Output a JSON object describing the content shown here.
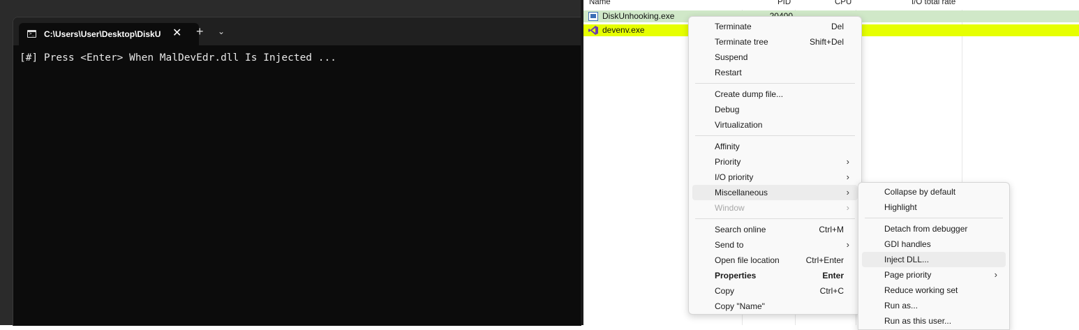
{
  "terminal": {
    "tab_title": "C:\\Users\\User\\Desktop\\DiskU",
    "tab_close": "✕",
    "new_tab": "+",
    "dropdown": "⌄",
    "output": "[#] Press <Enter> When MalDevEdr.dll Is Injected ..."
  },
  "process_list": {
    "columns": [
      "Name",
      "PID",
      "CPU",
      "I/O total rate"
    ],
    "rows": [
      {
        "name": "DiskUnhooking.exe",
        "pid": "20400",
        "highlight": "#d0e8c8"
      },
      {
        "name": "devenv.exe",
        "pid": "",
        "highlight": "#e6ff00"
      }
    ]
  },
  "context_menu": {
    "items": [
      {
        "label": "Terminate",
        "shortcut": "Del"
      },
      {
        "label": "Terminate tree",
        "shortcut": "Shift+Del"
      },
      {
        "label": "Suspend",
        "shortcut": ""
      },
      {
        "label": "Restart",
        "shortcut": ""
      },
      {
        "label": "Create dump file...",
        "shortcut": ""
      },
      {
        "label": "Debug",
        "shortcut": ""
      },
      {
        "label": "Virtualization",
        "shortcut": ""
      },
      {
        "label": "Affinity",
        "shortcut": ""
      },
      {
        "label": "Priority",
        "shortcut": ""
      },
      {
        "label": "I/O priority",
        "shortcut": ""
      },
      {
        "label": "Miscellaneous",
        "shortcut": ""
      },
      {
        "label": "Window",
        "shortcut": ""
      },
      {
        "label": "Search online",
        "shortcut": "Ctrl+M"
      },
      {
        "label": "Send to",
        "shortcut": ""
      },
      {
        "label": "Open file location",
        "shortcut": "Ctrl+Enter"
      },
      {
        "label": "Properties",
        "shortcut": "Enter"
      },
      {
        "label": "Copy",
        "shortcut": "Ctrl+C"
      },
      {
        "label": "Copy \"Name\"",
        "shortcut": ""
      }
    ],
    "submenu_arrow": "›"
  },
  "submenu_miscellaneous": {
    "items": [
      {
        "label": "Collapse by default"
      },
      {
        "label": "Highlight"
      },
      {
        "label": "Detach from debugger"
      },
      {
        "label": "GDI handles"
      },
      {
        "label": "Inject DLL..."
      },
      {
        "label": "Page priority"
      },
      {
        "label": "Reduce working set"
      },
      {
        "label": "Run as..."
      },
      {
        "label": "Run as this user..."
      }
    ]
  },
  "colors": {
    "terminal_bg": "#0c0c0c",
    "row_green": "#d0e8c8",
    "row_yellow": "#e6ff00",
    "menu_bg": "#f9f9f9"
  }
}
